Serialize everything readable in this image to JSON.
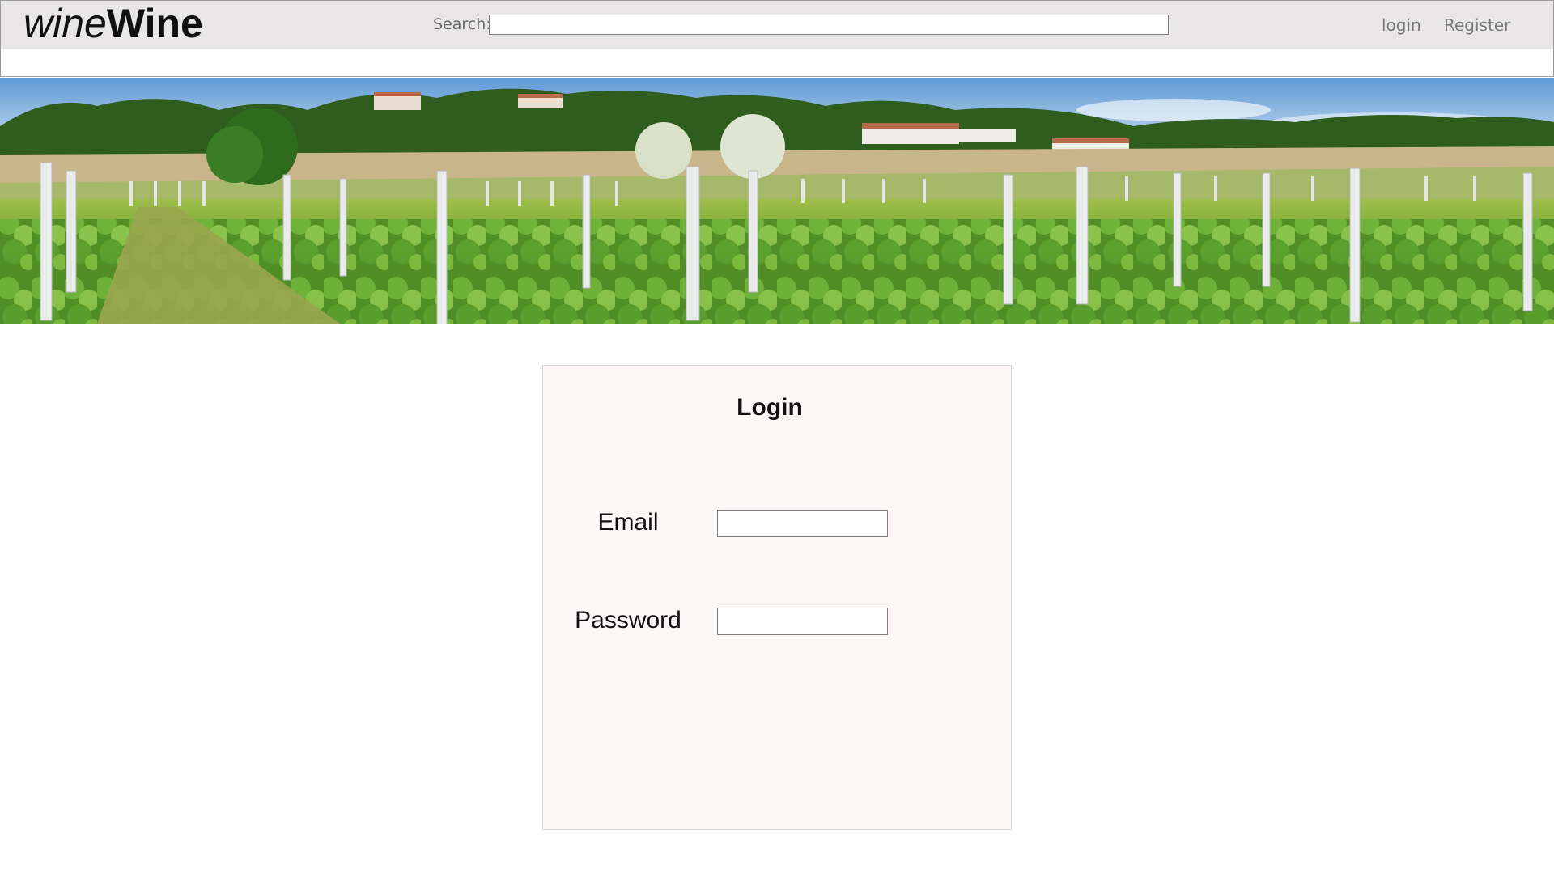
{
  "header": {
    "logo_light": "wine",
    "logo_bold": "Wine",
    "search_label": "Search:",
    "search_value": "",
    "nav": {
      "login": "login",
      "register": "Register"
    }
  },
  "banner": {
    "description_icon": "vineyard-banner-image"
  },
  "login_form": {
    "title": "Login",
    "email_label": "Email",
    "email_value": "",
    "password_label": "Password",
    "password_value": ""
  },
  "colors": {
    "header_bg": "#e8e6e6",
    "card_bg": "#faf7f6",
    "nav_text": "#7a7a7a",
    "text": "#111111"
  }
}
